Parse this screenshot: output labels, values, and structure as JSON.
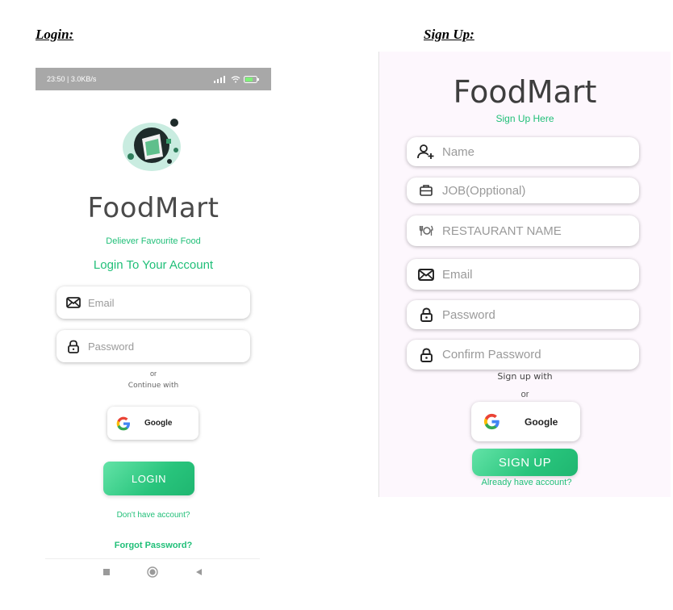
{
  "headings": {
    "login": "Login:",
    "signup": "Sign Up:"
  },
  "login": {
    "status_bar": {
      "left": "23:50 | 3.0KB/s",
      "battery": "ⵘ"
    },
    "brand": "FoodMart",
    "tagline": "Deliever Favourite Food",
    "heading": "Login To Your Account",
    "email_placeholder": "Email",
    "password_placeholder": "Password",
    "or": "or",
    "continue_with": "Continue with",
    "google_label": "Google",
    "login_button": "LOGIN",
    "no_account": "Don't have account?",
    "forgot_password": "Forgot Password?"
  },
  "signup": {
    "brand": "FoodMart",
    "tagline": "Sign Up Here",
    "name_placeholder": "Name",
    "job_placeholder": "JOB(Opptional)",
    "restaurant_placeholder": "RESTAURANT NAME",
    "email_placeholder": "Email",
    "password_placeholder": "Password",
    "confirm_password_placeholder": "Confirm Password",
    "signup_with": "Sign up with",
    "or": "or",
    "google_label": "Google",
    "signup_button": "SIGN UP",
    "have_account": "Already have account?"
  },
  "colors": {
    "accent": "#20bf78",
    "button_start": "#63e3a7",
    "button_end": "#1fb670",
    "status_bar": "#a8a8a8"
  },
  "icons": [
    "envelope-icon",
    "lock-icon",
    "add-user-icon",
    "briefcase-icon",
    "cutlery-icon",
    "google-icon",
    "nav-square-icon",
    "nav-circle-icon",
    "nav-back-icon"
  ]
}
